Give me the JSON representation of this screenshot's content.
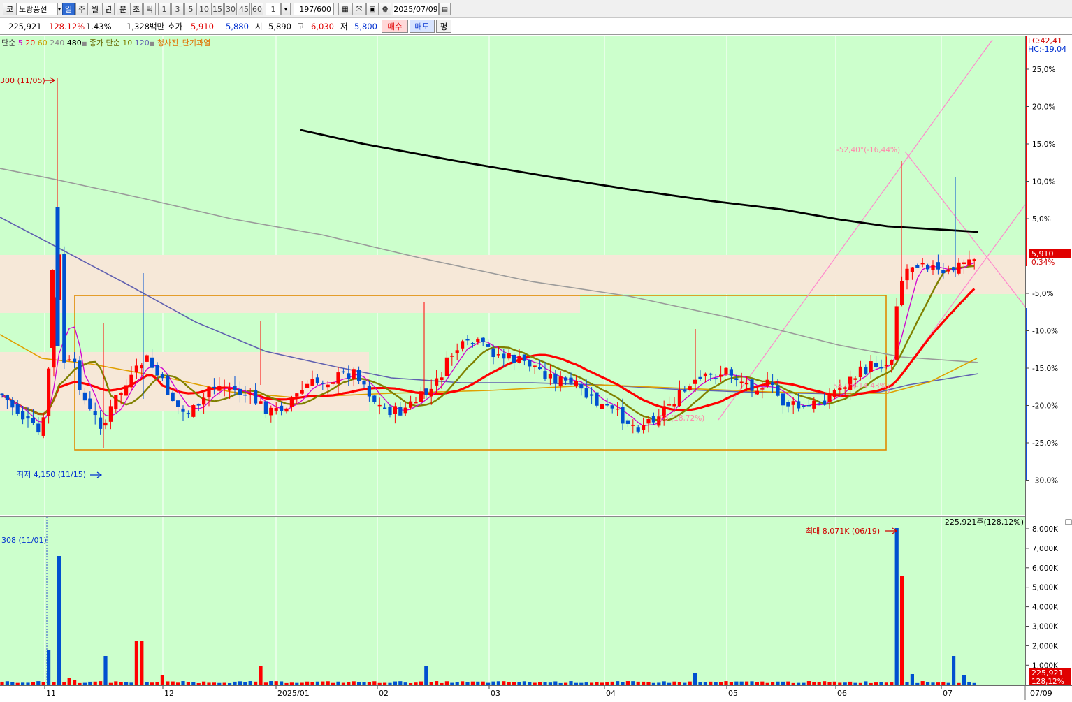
{
  "toolbar": {
    "market_code": "코",
    "stock_name": "노랑풍선",
    "periods": [
      "일",
      "주",
      "월",
      "년",
      "분",
      "초",
      "틱"
    ],
    "active_period": "일",
    "intervals": [
      "1",
      "3",
      "5",
      "10",
      "15",
      "30",
      "45",
      "60"
    ],
    "unit_value": "1",
    "count": "197/600",
    "date": "2025/07/09",
    "icons": [
      "candle-settings-icon",
      "indicator-icon",
      "save-icon",
      "gear-icon",
      "calendar-icon"
    ]
  },
  "quote": {
    "volume": "225,921",
    "volume_ratio": "128.12%",
    "turnover": "1.43%",
    "amount": "1,328백만",
    "bid_label": "호가",
    "ask_price": "5,910",
    "bid_price": "5,880",
    "open_label": "시",
    "open": "5,890",
    "high_label": "고",
    "high": "6,030",
    "low_label": "저",
    "low": "5,800",
    "buy_label": "매수",
    "sell_label": "매도",
    "eval_label": "평"
  },
  "legend": {
    "ma_label": "단순",
    "ma_periods": [
      "5",
      "20",
      "60",
      "240",
      "480"
    ],
    "ma_colors": [
      "#d000d0",
      "#ff0000",
      "#c8a000",
      "#9a9a9a",
      "#000000"
    ],
    "close_label": "종가 단순",
    "close_periods": [
      "10",
      "120"
    ],
    "close_colors": [
      "#808000",
      "#6060b0"
    ],
    "signal_label": "청사진_단기과열"
  },
  "annotations": {
    "high_marker": "300 (11/05)",
    "low_marker": "최저 4,150 (11/15)",
    "trend_up": "-52,40°(-16,44%)",
    "trend_mid": "54.0°(-14.43%)",
    "trend_low": ",26 (18,72%)",
    "vol_max": "최대 8,071K (06/19)",
    "vol_min": "308 (11/01)",
    "vol_current": "225,921주(128,12%)"
  },
  "price_scale": {
    "lc": "LC:42,41",
    "hc": "HC:-19,04",
    "ticks": [
      "25,0%",
      "20,0%",
      "15,0%",
      "10,0%",
      "5,0%",
      "0,0%",
      "-5,0%",
      "-10,0%",
      "-15,0%",
      "-20,0%",
      "-25,0%",
      "-30,0%"
    ],
    "current_price": "5,910",
    "current_change": "0,34%"
  },
  "volume_scale": {
    "ticks": [
      "8,000K",
      "7,000K",
      "6,000K",
      "5,000K",
      "4,000K",
      "3,000K",
      "2,000K",
      "1,000K"
    ],
    "current_volume": "225,921",
    "current_ratio": "128,12%"
  },
  "xaxis": {
    "labels": [
      "11",
      "12",
      "2025/01",
      "02",
      "03",
      "04",
      "05",
      "06",
      "07"
    ],
    "end_date": "07/09"
  },
  "colors": {
    "up": "#ff0000",
    "down": "#0050d0",
    "background": "#ccffcc",
    "zone": "#f6e8d8",
    "box": "#e08a00",
    "channel": "#ff88cc"
  }
}
